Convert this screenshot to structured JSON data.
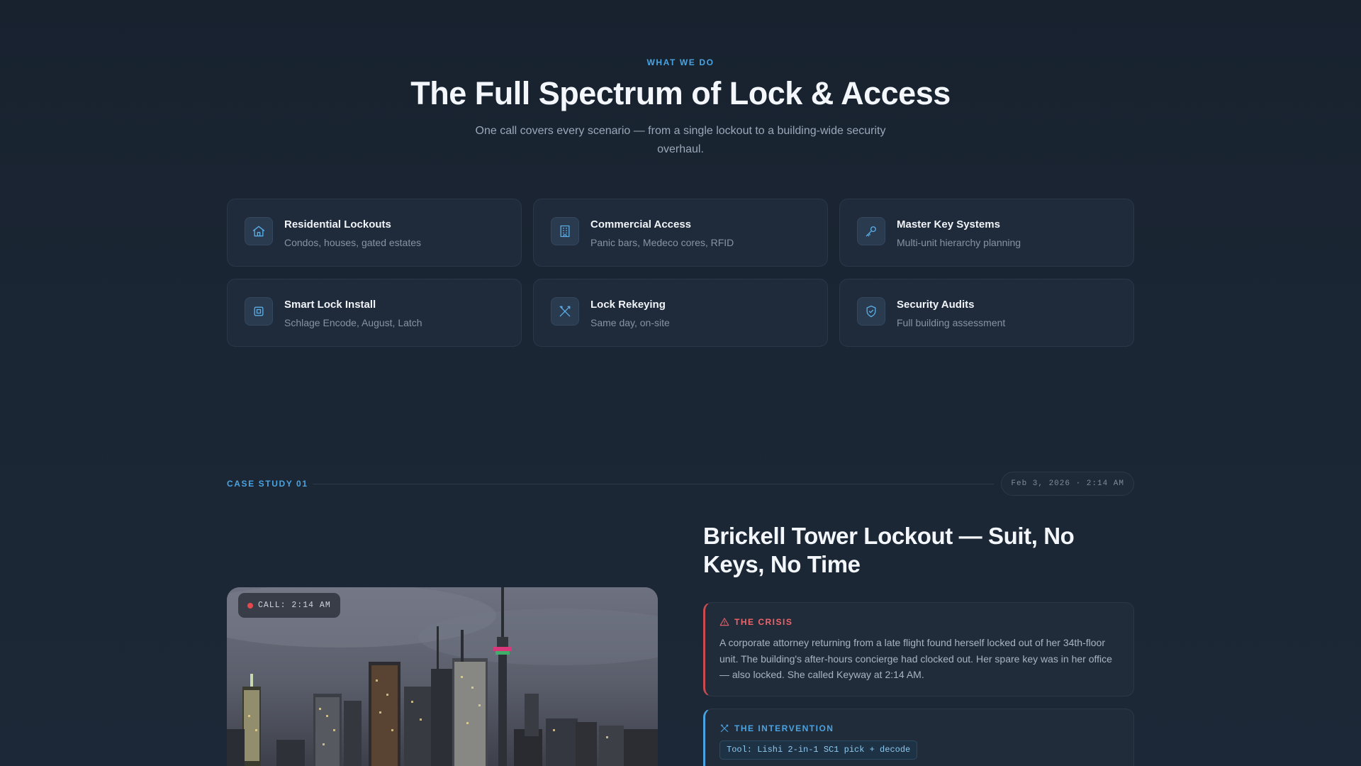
{
  "services": {
    "eyebrow": "WHAT WE DO",
    "title": "The Full Spectrum of Lock & Access",
    "subtitle": "One call covers every scenario — from a single lockout to a building-wide security overhaul.",
    "cards": [
      {
        "icon": "home-icon",
        "title": "Residential Lockouts",
        "desc": "Condos, houses, gated estates"
      },
      {
        "icon": "building-icon",
        "title": "Commercial Access",
        "desc": "Panic bars, Medeco cores, RFID"
      },
      {
        "icon": "key-icon",
        "title": "Master Key Systems",
        "desc": "Multi-unit hierarchy planning"
      },
      {
        "icon": "chip-icon",
        "title": "Smart Lock Install",
        "desc": "Schlage Encode, August, Latch"
      },
      {
        "icon": "tools-icon",
        "title": "Lock Rekeying",
        "desc": "Same day, on-site"
      },
      {
        "icon": "shield-icon",
        "title": "Security Audits",
        "desc": "Full building assessment"
      }
    ]
  },
  "case_study": {
    "label": "CASE STUDY 01",
    "date": "Feb 3, 2026 · 2:14 AM",
    "call_badge": "CALL: 2:14 AM",
    "title": "Brickell Tower Lockout — Suit, No Keys, No Time",
    "crisis": {
      "heading": "THE CRISIS",
      "body": "A corporate attorney returning from a late flight found herself locked out of her 34th-floor unit. The building's after-hours concierge had clocked out. Her spare key was in her office — also locked. She called Keyway at 2:14 AM."
    },
    "intervention": {
      "heading": "THE INTERVENTION",
      "tool": "Tool: Lishi 2-in-1 SC1 pick + decode"
    }
  },
  "colors": {
    "accent": "#4aa3e0",
    "danger": "#f06469",
    "background": "#1b2634",
    "card": "#1f2b3a"
  }
}
